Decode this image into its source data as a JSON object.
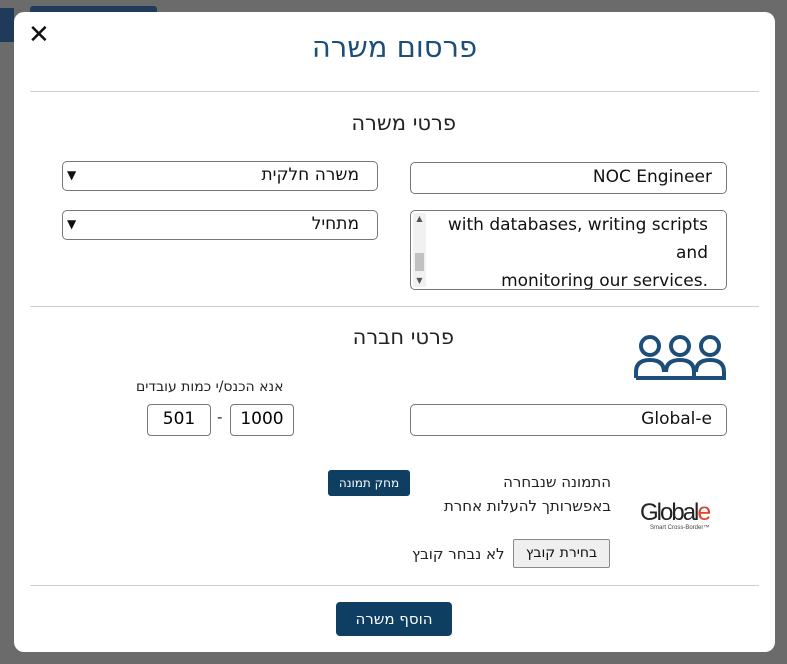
{
  "modal": {
    "title": "פרסום משרה",
    "close_glyph": "✕"
  },
  "job_section": {
    "title": "פרטי משרה",
    "job_title_value": "NOC Engineer",
    "job_type_selected": "משרה חלקית",
    "level_selected": "מתחיל",
    "description_lines": [
      "with databases, writing scripts and",
      ".monitoring our services"
    ]
  },
  "company_section": {
    "title": "פרטי חברה",
    "icon": "users-group-icon",
    "company_name_value": "Global-e",
    "employees_label": "אנא הכנס/י כמות עובדים",
    "employees_min": "501",
    "employees_max": "1000",
    "range_separator": "-",
    "image_selected_text": "התמונה שנבחרה",
    "upload_other_text": "באפשרותך להעלות אחרת",
    "delete_image_label": "מחק תמונה",
    "choose_file_label": "בחירת קובץ",
    "no_file_text": "לא נבחר קובץ",
    "logo_text": "Global",
    "logo_e": "e",
    "logo_tagline": "Smart Cross-Border™"
  },
  "footer": {
    "add_job_label": "הוסף משרה"
  },
  "colors": {
    "accent": "#1d4e7a",
    "button": "#0f3e63",
    "logo_e": "#e2422b"
  }
}
